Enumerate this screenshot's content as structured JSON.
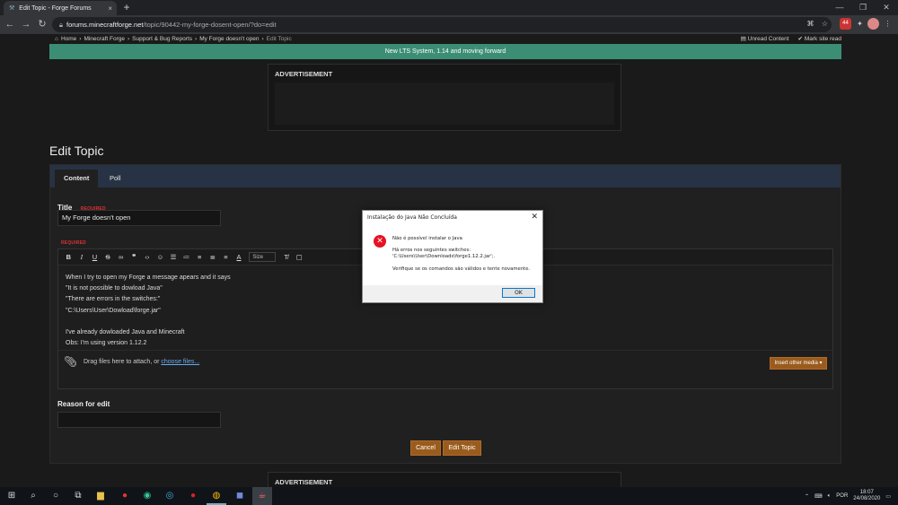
{
  "browser": {
    "tab_title": "Edit Topic - Forge Forums",
    "tab_close": "×",
    "new_tab": "+",
    "url_host": "forums.minecraftforge.net",
    "url_path": "/topic/90442-my-forge-dosent-open/?do=edit",
    "window_controls": [
      "—",
      "❐",
      "✕"
    ]
  },
  "breadcrumb": [
    "Home",
    "Minecraft Forge",
    "Support & Bug Reports",
    "My Forge doesn't open",
    "Edit Topic"
  ],
  "breadcrumb_sep": "›",
  "top_links": {
    "unread": "Unread Content",
    "mark_read": "Mark site read"
  },
  "banner": "New LTS System, 1.14 and moving forward",
  "advert_title": "ADVERTISEMENT",
  "page_title": "Edit Topic",
  "tabs": {
    "content": "Content",
    "poll": "Poll"
  },
  "form": {
    "title_label": "Title",
    "required": "REQUIRED",
    "title_value": "My Forge doesn't open",
    "size_label": "Size",
    "body_lines": [
      "When I try to open my Forge a message apears and it says",
      "\"It is not possible to dowload Java\"",
      "\"There are errors in the switches:\"",
      "\"C:\\Users\\User\\Dowload\\forge.jar\"",
      "",
      "I've already dowloaded Java and Minecraft",
      "Obs: I'm using version 1.12.2"
    ],
    "attach_text": "Drag files here to attach, or",
    "attach_link": "choose files...",
    "insert_media": "Insert other media ▾",
    "reason_label": "Reason for edit",
    "reason_value": "",
    "cancel": "Cancel",
    "submit": "Edit Topic"
  },
  "dialog": {
    "title": "Instalação do Java Não Concluída",
    "close": "✕",
    "line1": "Não é possível instalar o Java",
    "line2": "Há erros nos seguintes switches:",
    "line3": "'C:\\Users\\User\\Downloads\\forge1.12.2.jar';.",
    "line4": "Verifique se os comandos são válidos e tente novamente.",
    "ok": "OK"
  },
  "taskbar": {
    "lang": "POR",
    "time": "18:07",
    "date": "24/08/2020"
  },
  "colors": {
    "banner": "#3b8e73",
    "tabs_bar": "#273344",
    "accent_button": "#9a5b1c",
    "error": "#e81123"
  }
}
